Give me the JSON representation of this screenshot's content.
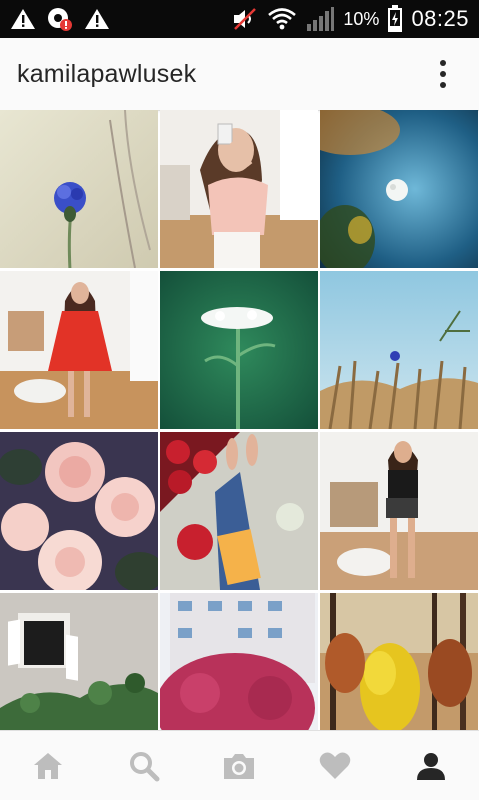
{
  "status_bar": {
    "left_icons": [
      "warning-icon",
      "alert-circle-icon",
      "warning-icon"
    ],
    "right_icons": [
      "mute-icon",
      "wifi-icon",
      "signal-icon",
      "battery-charging-icon"
    ],
    "battery_percent": "10%",
    "time": "08:25"
  },
  "app_bar": {
    "username": "kamilapawlusek",
    "menu_icon": "more-vertical-icon"
  },
  "grid": {
    "tiles": [
      {
        "name": "cornflower-photo"
      },
      {
        "name": "mirror-selfie-pink-top-photo"
      },
      {
        "name": "moon-bokeh-photo"
      },
      {
        "name": "red-dress-selfie-photo"
      },
      {
        "name": "white-wildflower-photo"
      },
      {
        "name": "wheat-field-sky-photo"
      },
      {
        "name": "pink-roses-photo"
      },
      {
        "name": "feet-book-roses-photo"
      },
      {
        "name": "black-outfit-selfie-photo"
      },
      {
        "name": "window-ivy-photo"
      },
      {
        "name": "pink-tree-building-photo"
      },
      {
        "name": "autumn-forest-photo"
      }
    ]
  },
  "bottom_nav": {
    "items": [
      "home-icon",
      "search-icon",
      "camera-icon",
      "heart-icon",
      "profile-icon"
    ],
    "active": "profile-icon",
    "colors": {
      "inactive": "#bdbdbd",
      "active": "#262626"
    }
  }
}
